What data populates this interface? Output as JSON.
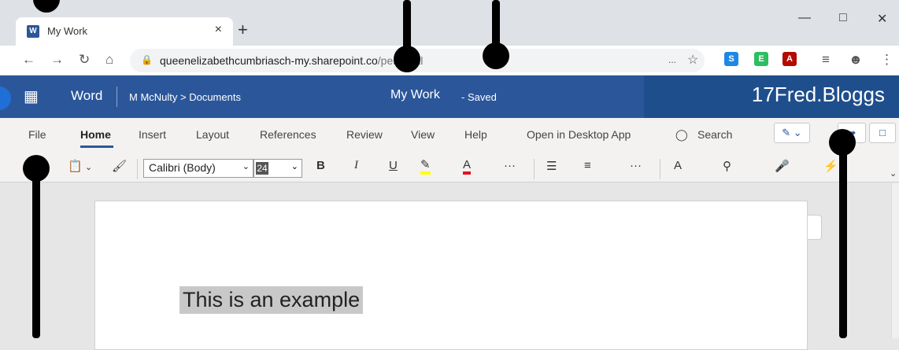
{
  "browser": {
    "tab_title": "My Work",
    "tab_favicon_letter": "W",
    "tab_close": "×",
    "new_tab": "+",
    "url_main": "queenelizabethcumbriasch-my.sharepoint.co",
    "url_rest": "personal",
    "addr_more": "..."
  },
  "word": {
    "app_name": "Word",
    "breadcrumb": "M McNulty > Documents",
    "doc_title": "My Work",
    "status": "- Saved",
    "username": "17Fred.Bloggs"
  },
  "ribbon": {
    "tabs": [
      "File",
      "Home",
      "Insert",
      "Layout",
      "References",
      "Review",
      "View",
      "Help",
      "Open in Desktop App"
    ],
    "search_label": "Search",
    "font_name": "Calibri (Body)",
    "font_size": "24",
    "bold": "B",
    "italic": "I",
    "underline": "U",
    "more": "···"
  },
  "document": {
    "text": "This is an example"
  },
  "colors": {
    "word_blue": "#2b579a",
    "highlight_yellow": "#ffff00",
    "font_red": "#e81123"
  }
}
